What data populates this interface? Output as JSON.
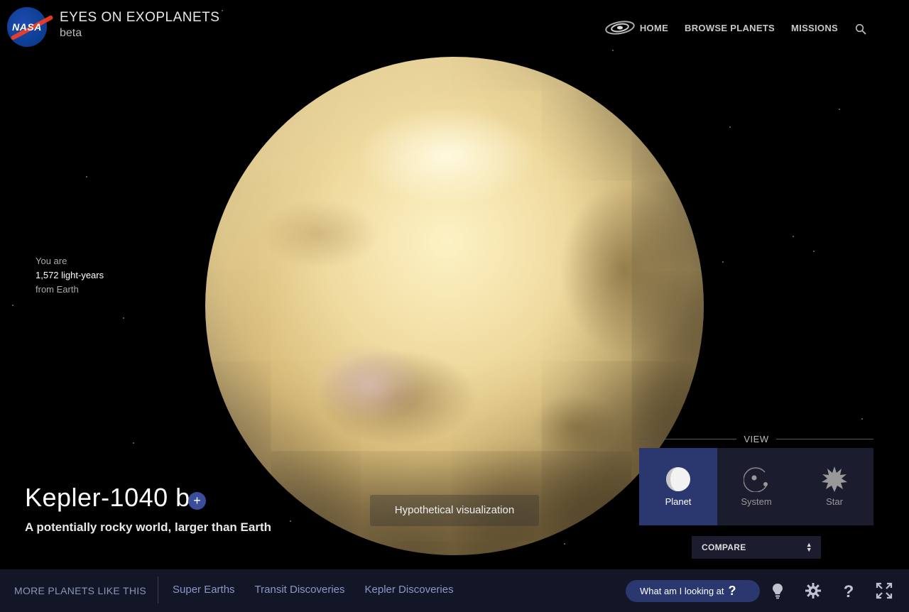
{
  "header": {
    "logo_text": "NASA",
    "title": "EYES ON EXOPLANETS",
    "subtitle": "beta",
    "nav": [
      {
        "label": "HOME"
      },
      {
        "label": "BROWSE PLANETS"
      },
      {
        "label": "MISSIONS"
      }
    ],
    "icons": [
      "galaxy-icon",
      "search-icon"
    ]
  },
  "distance": {
    "prefix": "You are",
    "value": "1,572 light-years",
    "suffix": "from Earth"
  },
  "planet": {
    "name": "Kepler-1040 b",
    "add_label": "+",
    "description": "A potentially rocky world, larger than Earth"
  },
  "overlay": {
    "hypothetical": "Hypothetical visualization"
  },
  "view": {
    "label": "VIEW",
    "options": [
      {
        "label": "Planet",
        "icon": "planet-icon",
        "active": true
      },
      {
        "label": "System",
        "icon": "system-icon",
        "active": false
      },
      {
        "label": "Star",
        "icon": "star-icon",
        "active": false
      }
    ],
    "compare_label": "COMPARE"
  },
  "bottom": {
    "more_label": "MORE PLANETS LIKE THIS",
    "links": [
      {
        "label": "Super Earths"
      },
      {
        "label": "Transit Discoveries"
      },
      {
        "label": "Kepler Discoveries"
      }
    ],
    "what_label": "What am I looking at",
    "what_q": "?",
    "tools": [
      "lightbulb-icon",
      "settings-icon",
      "help-icon",
      "fullscreen-icon"
    ]
  },
  "colors": {
    "accent": "#2b3870",
    "panel": "#1b1c2e",
    "bottombar": "#121626",
    "link": "#8c96c8"
  }
}
